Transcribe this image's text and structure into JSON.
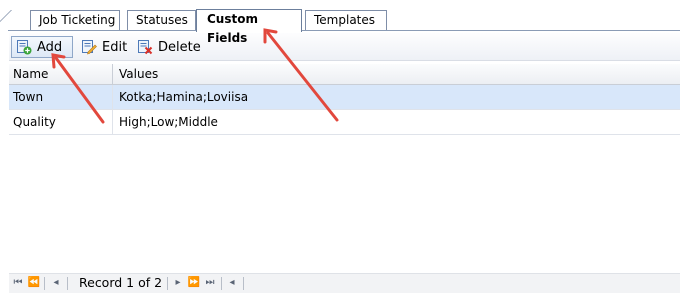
{
  "tabs": [
    {
      "label": "Job Ticketing",
      "active": false
    },
    {
      "label": "Statuses",
      "active": false
    },
    {
      "label": "Custom Fields",
      "active": true
    },
    {
      "label": "Templates",
      "active": false
    }
  ],
  "toolbar": {
    "add_label": "Add",
    "edit_label": "Edit",
    "delete_label": "Delete"
  },
  "grid": {
    "columns": [
      "Name",
      "Values"
    ],
    "rows": [
      {
        "name": "Town",
        "values": "Kotka;Hamina;Loviisa",
        "selected": true
      },
      {
        "name": "Quality",
        "values": "High;Low;Middle",
        "selected": false
      }
    ]
  },
  "navigator": {
    "record_text": "Record 1 of 2"
  },
  "colors": {
    "selected_row": "#d8e7fa",
    "annotation_arrow": "#e2483d"
  }
}
